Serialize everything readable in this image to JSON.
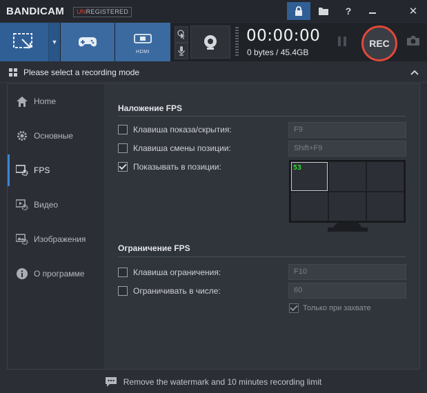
{
  "app": {
    "logo": "BANDICAM",
    "badge_red": "UN",
    "badge_rest": "REGISTERED"
  },
  "toolbar": {
    "hdmi_label": "HDMI",
    "timer": "00:00:00",
    "size": "0 bytes / 45.4GB",
    "rec_label": "REC"
  },
  "mode_bar": {
    "title": "Please select a recording mode"
  },
  "sidebar": {
    "items": [
      {
        "label": "Home",
        "icon": "home-icon"
      },
      {
        "label": "Основные",
        "icon": "gear-icon"
      },
      {
        "label": "FPS",
        "icon": "fps-icon"
      },
      {
        "label": "Видео",
        "icon": "video-icon"
      },
      {
        "label": "Изображения",
        "icon": "image-icon"
      },
      {
        "label": "О программе",
        "icon": "info-icon"
      }
    ],
    "active": "FPS"
  },
  "fps_overlay": {
    "title": "Наложение FPS",
    "show_hide_key": {
      "label": "Клавиша показа/скрытия:",
      "checked": false,
      "value": "F9"
    },
    "position_key": {
      "label": "Клавиша смены позиции:",
      "checked": false,
      "value": "Shift+F9"
    },
    "show_at_position": {
      "label": "Показывать в позиции:",
      "checked": true
    },
    "preview_fps": "53"
  },
  "fps_limit": {
    "title": "Ограничение FPS",
    "limit_key": {
      "label": "Клавиша ограничения:",
      "checked": false,
      "value": "F10"
    },
    "limit_to": {
      "label": "Ограничивать в числе:",
      "checked": false,
      "value": "60"
    },
    "only_capture": {
      "label": "Только при захвате",
      "checked": true
    }
  },
  "footer": {
    "text": "Remove the watermark and 10 minutes recording limit"
  },
  "colors": {
    "accent_blue": "#2f5f95",
    "rec_red": "#e2483a",
    "fps_green": "#32e032"
  }
}
